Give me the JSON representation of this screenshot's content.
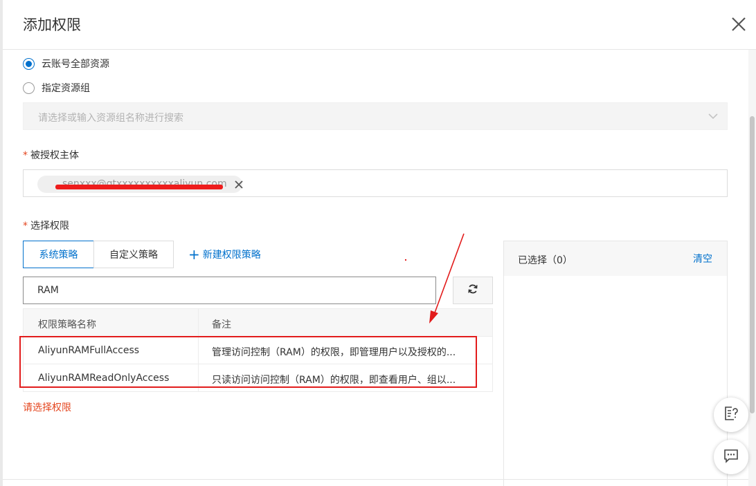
{
  "dialog": {
    "title": "添加权限"
  },
  "scope": {
    "option_all": "云账号全部资源",
    "option_group": "指定资源组",
    "group_placeholder": "请选择或输入资源组名称进行搜索"
  },
  "principal": {
    "required_mark": "*",
    "label": "被授权主体",
    "tag_text": "senxxx@gtxxxxxxxxxxaliyun.com"
  },
  "permissions": {
    "required_mark": "*",
    "label": "选择权限",
    "tab_system": "系统策略",
    "tab_custom": "自定义策略",
    "new_policy": "新建权限策略",
    "search_value": "RAM",
    "table_headers": [
      "权限策略名称",
      "备注"
    ],
    "rows": [
      {
        "name": "AliyunRAMFullAccess",
        "note": "管理访问控制（RAM）的权限，即管理用户以及授权的..."
      },
      {
        "name": "AliyunRAMReadOnlyAccess",
        "note": "只读访问访问控制（RAM）的权限，即查看用户、组以..."
      }
    ],
    "error": "请选择权限"
  },
  "selected": {
    "title": "已选择（0）",
    "clear": "清空"
  },
  "icons": {
    "close": "close-icon",
    "chevron": "chevron-down-icon",
    "refresh": "refresh-icon",
    "help": "help-doc-icon",
    "chat": "chat-icon"
  },
  "colors": {
    "accent": "#0070cc",
    "error": "#e4461f",
    "annotation": "#e21b1b"
  }
}
